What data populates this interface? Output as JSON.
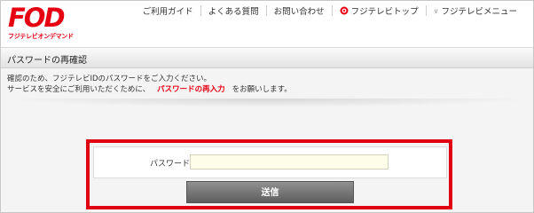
{
  "logo": {
    "main": "FOD",
    "sub": "フジテレビオンデマンド"
  },
  "nav": {
    "items": [
      {
        "label": "ご利用ガイド"
      },
      {
        "label": "よくある質問"
      },
      {
        "label": "お問い合わせ"
      },
      {
        "label": "フジテレビトップ",
        "icon": "eye-icon"
      },
      {
        "label": "フジテレビメニュー",
        "icon": "chevron-down-icon"
      }
    ]
  },
  "page": {
    "title": "パスワードの再確認",
    "desc_line1": "確認のため、フジテレビIDのパスワードをご入力ください。",
    "desc_line2_pre": "サービスを安全にご利用いただくために、",
    "desc_line2_em": "パスワードの再入力",
    "desc_line2_post": "をお願いします。"
  },
  "form": {
    "password_label": "パスワード",
    "password_value": "",
    "submit_label": "送信"
  },
  "colors": {
    "brand": "#e60012",
    "highlight": "#e00012"
  }
}
